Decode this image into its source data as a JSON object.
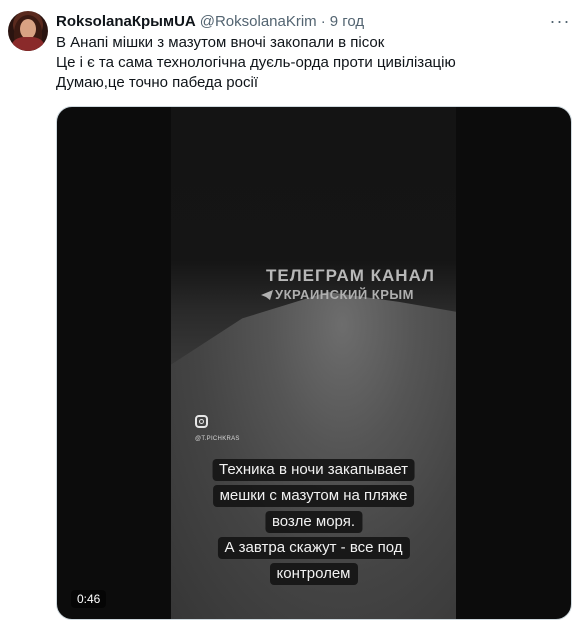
{
  "tweet": {
    "display_name": "RoksolanaКрымUA",
    "handle": "@RoksolanaKrim",
    "separator": "·",
    "time": "9 год",
    "more_label": "···",
    "lines": [
      "В Анапі мішки з мазутом вночі закопали в пісок",
      "Це і є та сама технологічна дуєль-орда проти цивілізацію",
      "Думаю,це точно пабеда росії"
    ]
  },
  "video": {
    "watermark_line1": "ТЕЛЕГРАМ КАНАЛ",
    "watermark_line2": "УКРАИНСКИЙ КРЫМ",
    "instagram_handle": "@T.PICHKRAS",
    "captions": [
      "Техника в ночи закапывает",
      "мешки с мазутом на пляже",
      "возле моря.",
      "А завтра скажут - все под",
      "контролем"
    ],
    "duration": "0:46"
  },
  "colors": {
    "text_primary": "#0f1419",
    "text_secondary": "#536471",
    "media_border": "#cfd9de"
  },
  "icons": {
    "more": "ellipsis-icon",
    "instagram": "instagram-icon",
    "telegram": "telegram-icon"
  }
}
